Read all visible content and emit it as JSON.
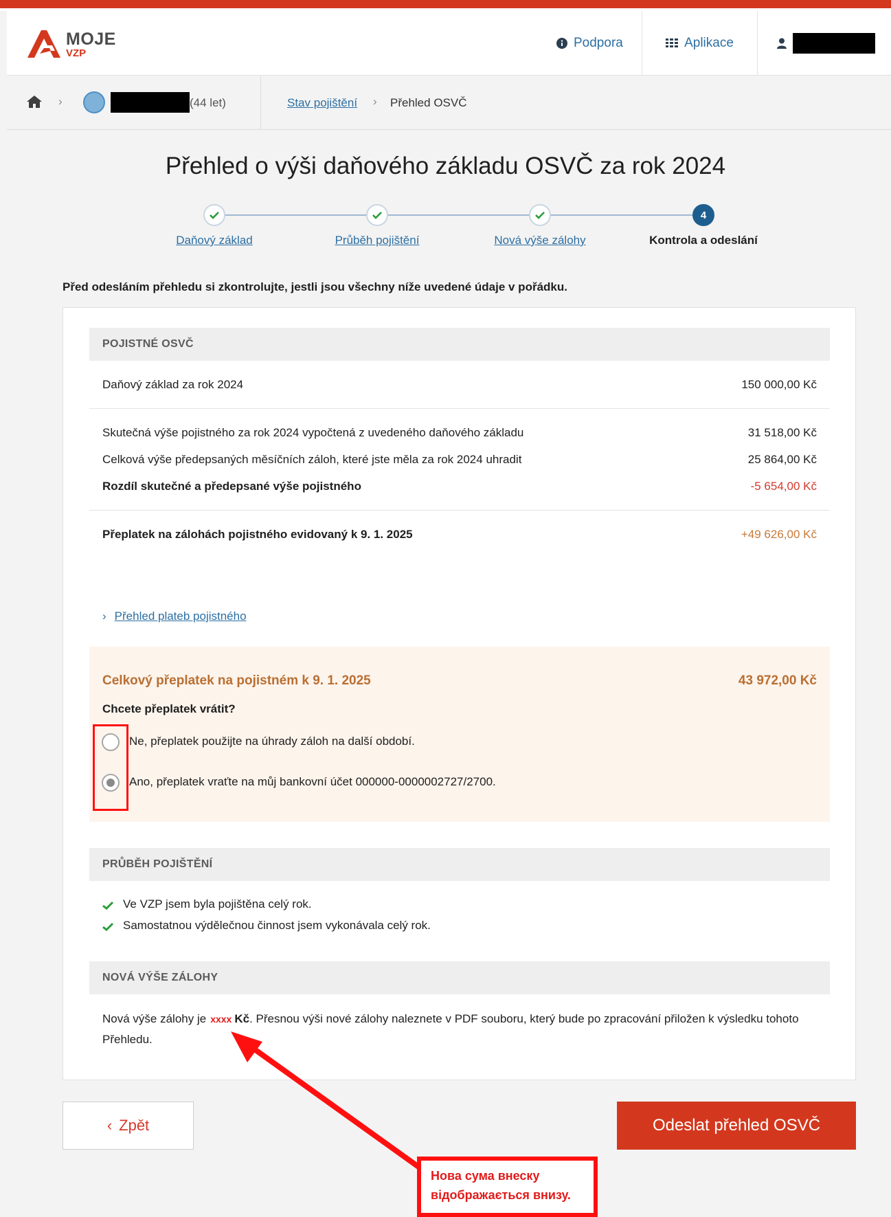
{
  "header": {
    "logo_top": "MOJE",
    "logo_bottom": "VZP",
    "support_label": "Podpora",
    "apps_label": "Aplikace"
  },
  "breadcrumb": {
    "age": "(44 let)",
    "link": "Stav pojištění",
    "current": "Přehled OSVČ"
  },
  "page": {
    "title": "Přehled o výši daňového základu OSVČ za rok 2024",
    "intro": "Před odesláním přehledu si zkontrolujte, jestli jsou všechny níže uvedené údaje v pořádku."
  },
  "steps": [
    {
      "label": "Daňový základ",
      "state": "done"
    },
    {
      "label": "Průběh pojištění",
      "state": "done"
    },
    {
      "label": "Nová výše zálohy",
      "state": "done"
    },
    {
      "label": "Kontrola a odeslání",
      "state": "active",
      "number": "4"
    }
  ],
  "premium": {
    "heading": "POJISTNÉ OSVČ",
    "rows": [
      {
        "label": "Daňový základ za rok 2024",
        "value": "150 000,00 Kč"
      },
      {
        "label": "Skutečná výše pojistného za rok 2024 vypočtená z uvedeného daňového základu",
        "value": "31 518,00 Kč"
      },
      {
        "label": "Celková výše předepsaných měsíčních záloh, které jste měla za rok 2024 uhradit",
        "value": "25 864,00 Kč"
      },
      {
        "label": "Rozdíl skutečné a předepsané výše pojistného",
        "value": "-5 654,00 Kč"
      },
      {
        "label": "Přeplatek na zálohách pojistného evidovaný k 9. 1. 2025",
        "value": "+49 626,00 Kč"
      }
    ],
    "payments_link": "Přehled plateb pojistného"
  },
  "refund": {
    "total_label": "Celkový přeplatek na pojistném k 9. 1. 2025",
    "total_value": "43 972,00 Kč",
    "question": "Chcete přeplatek vrátit?",
    "options": [
      {
        "label": "Ne, přeplatek použijte na úhrady záloh na další období.",
        "checked": false
      },
      {
        "label": "Ano, přeplatek vraťte na můj bankovní účet 000000-0000002727/2700.",
        "checked": true
      }
    ]
  },
  "insurance_course": {
    "heading": "PRŮBĚH POJIŠTĚNÍ",
    "items": [
      "Ve VZP jsem byla pojištěna celý rok.",
      "Samostatnou výdělečnou činnost jsem vykonávala celý rok."
    ]
  },
  "new_advance": {
    "heading": "NOVÁ VÝŠE ZÁLOHY",
    "text_before": "Nová výše zálohy je",
    "amount": "xxxx",
    "currency": "Kč",
    "text_after": ". Přesnou výši nové zálohy naleznete v PDF souboru, který bude po zpracování přiložen k výsledku tohoto Přehledu."
  },
  "buttons": {
    "back": "Zpět",
    "send": "Odeslat přehled OSVČ"
  },
  "annotation": {
    "line1": "Нова сума внеску",
    "line2": "відображається внизу."
  },
  "colors": {
    "brand_red": "#d3381e",
    "link_blue": "#2c6fa3",
    "step_active": "#1d5e8f",
    "check_green": "#2a9d3a",
    "negative_red": "#d33a2c",
    "refund_orange": "#b96f32",
    "annotation_red": "#ff1010"
  },
  "icons": {
    "support": "info-circle-icon",
    "apps": "grid-icon",
    "user": "user-icon",
    "home": "home-icon",
    "step_done": "checkmark-icon",
    "list_check": "checkmark-icon"
  }
}
